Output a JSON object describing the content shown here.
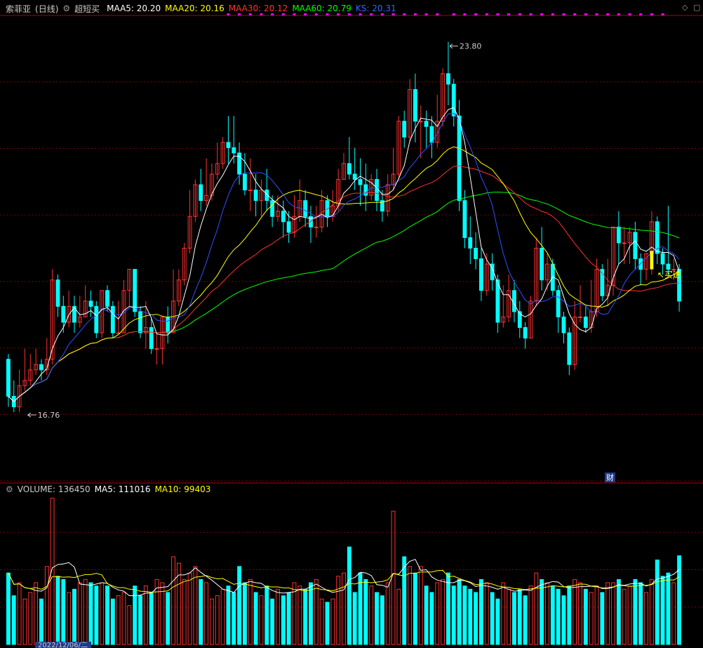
{
  "header": {
    "stock_name": "索菲亚",
    "period": "(日线)",
    "indicator_name": "超短买",
    "ma_labels": [
      {
        "label": "MAA5: 20.20",
        "color": "#ffffff"
      },
      {
        "label": "MAA20: 20.16",
        "color": "#ffff00"
      },
      {
        "label": "MAA30: 20.12",
        "color": "#ff3030"
      },
      {
        "label": "MAA60: 20.79",
        "color": "#00ff00"
      },
      {
        "label": "KS: 20.31",
        "color": "#3050ff"
      }
    ]
  },
  "volume_header": {
    "label": "VOLUME: 136450",
    "ma5": "MA5: 111016",
    "ma10": "MA10: 99403"
  },
  "annotations": {
    "high": "23.80",
    "low": "16.76",
    "buy_signal": "买进",
    "finance_marker": "财",
    "date_footer": "2022/12/06/二"
  },
  "colors": {
    "up": "#ff3030",
    "down": "#00ffff",
    "ma5": "#ffffff",
    "ma20": "#ffff00",
    "ma30": "#ff3030",
    "ma60": "#00ff00",
    "ks": "#3050ff",
    "grid": "#7a0000",
    "signal_dot": "#ff00ff"
  },
  "chart_data": {
    "type": "candlestick",
    "y_range": [
      15.5,
      24.3
    ],
    "volume_range": [
      0,
      230000
    ],
    "candles": [
      [
        17.8,
        17.1,
        17.9,
        16.9,
        110000
      ],
      [
        17.1,
        16.9,
        17.4,
        16.8,
        75000
      ],
      [
        16.9,
        17.3,
        17.6,
        16.8,
        95000
      ],
      [
        17.3,
        17.4,
        18.0,
        17.2,
        70000
      ],
      [
        17.4,
        17.6,
        17.9,
        17.3,
        80000
      ],
      [
        17.6,
        17.7,
        18.0,
        17.5,
        95000
      ],
      [
        17.7,
        17.6,
        17.8,
        17.4,
        70000
      ],
      [
        17.6,
        17.8,
        18.2,
        17.5,
        120000
      ],
      [
        17.8,
        19.3,
        19.5,
        17.7,
        225000
      ],
      [
        19.3,
        18.8,
        19.4,
        18.6,
        105000
      ],
      [
        18.8,
        18.5,
        19.0,
        18.3,
        100000
      ],
      [
        18.5,
        18.8,
        19.1,
        18.4,
        80000
      ],
      [
        18.8,
        18.5,
        19.0,
        18.3,
        85000
      ],
      [
        18.5,
        18.6,
        19.0,
        18.4,
        95000
      ],
      [
        18.6,
        18.9,
        19.2,
        18.6,
        100000
      ],
      [
        18.9,
        18.8,
        19.1,
        18.6,
        95000
      ],
      [
        18.8,
        18.3,
        18.9,
        18.2,
        90000
      ],
      [
        18.3,
        19.1,
        19.1,
        18.2,
        95000
      ],
      [
        19.1,
        18.8,
        19.2,
        18.7,
        90000
      ],
      [
        18.8,
        18.3,
        18.9,
        18.2,
        70000
      ],
      [
        18.3,
        18.3,
        18.9,
        18.3,
        75000
      ],
      [
        18.3,
        19.1,
        19.3,
        18.3,
        80000
      ],
      [
        19.1,
        19.5,
        19.5,
        18.8,
        60000
      ],
      [
        19.5,
        18.7,
        19.5,
        18.6,
        90000
      ],
      [
        18.7,
        18.3,
        18.8,
        18.2,
        75000
      ],
      [
        18.3,
        18.4,
        18.9,
        18.0,
        90000
      ],
      [
        18.4,
        18.0,
        18.6,
        17.9,
        80000
      ],
      [
        18.0,
        18.0,
        18.3,
        17.7,
        100000
      ],
      [
        18.0,
        18.6,
        18.6,
        17.7,
        95000
      ],
      [
        18.6,
        18.3,
        18.8,
        18.1,
        80000
      ],
      [
        18.3,
        18.9,
        19.5,
        18.3,
        135000
      ],
      [
        18.9,
        19.3,
        19.5,
        18.8,
        125000
      ],
      [
        19.3,
        19.9,
        20.0,
        19.2,
        100000
      ],
      [
        19.9,
        20.5,
        21.0,
        19.8,
        110000
      ],
      [
        20.5,
        21.1,
        21.2,
        20.4,
        120000
      ],
      [
        21.1,
        20.8,
        21.4,
        20.6,
        100000
      ],
      [
        20.8,
        20.9,
        21.6,
        20.7,
        95000
      ],
      [
        20.9,
        21.3,
        21.5,
        20.8,
        70000
      ],
      [
        21.3,
        21.5,
        21.9,
        21.2,
        75000
      ],
      [
        21.5,
        21.9,
        22.0,
        21.4,
        85000
      ],
      [
        21.9,
        21.8,
        22.4,
        21.5,
        90000
      ],
      [
        21.8,
        21.7,
        22.4,
        21.5,
        80000
      ],
      [
        21.7,
        21.3,
        21.9,
        21.1,
        120000
      ],
      [
        21.3,
        21.0,
        21.7,
        20.9,
        95000
      ],
      [
        21.0,
        21.0,
        21.6,
        20.6,
        100000
      ],
      [
        21.0,
        20.8,
        21.3,
        20.5,
        80000
      ],
      [
        20.8,
        21.0,
        21.2,
        20.5,
        75000
      ],
      [
        21.0,
        20.8,
        21.4,
        20.6,
        90000
      ],
      [
        20.8,
        20.5,
        20.9,
        20.3,
        70000
      ],
      [
        20.5,
        20.6,
        20.9,
        20.4,
        85000
      ],
      [
        20.6,
        20.4,
        20.8,
        20.1,
        75000
      ],
      [
        20.4,
        20.2,
        20.6,
        20.0,
        80000
      ],
      [
        20.2,
        20.5,
        20.9,
        20.1,
        95000
      ],
      [
        20.5,
        20.8,
        21.2,
        20.4,
        90000
      ],
      [
        20.8,
        20.5,
        21.0,
        20.3,
        85000
      ],
      [
        20.5,
        20.3,
        20.7,
        20.0,
        95000
      ],
      [
        20.3,
        20.3,
        20.7,
        20.1,
        100000
      ],
      [
        20.3,
        20.8,
        21.0,
        20.2,
        70000
      ],
      [
        20.8,
        20.5,
        20.9,
        20.3,
        65000
      ],
      [
        20.5,
        20.7,
        21.0,
        20.4,
        70000
      ],
      [
        20.7,
        21.2,
        21.4,
        20.6,
        105000
      ],
      [
        21.2,
        21.5,
        21.7,
        21.2,
        110000
      ],
      [
        21.5,
        21.3,
        22.0,
        21.2,
        150000
      ],
      [
        21.3,
        21.2,
        21.8,
        21.0,
        80000
      ],
      [
        21.2,
        21.1,
        21.6,
        20.7,
        110000
      ],
      [
        21.1,
        20.9,
        21.5,
        20.6,
        100000
      ],
      [
        20.9,
        21.2,
        21.3,
        20.8,
        90000
      ],
      [
        21.2,
        20.8,
        21.4,
        20.6,
        80000
      ],
      [
        20.8,
        20.6,
        21.0,
        20.4,
        75000
      ],
      [
        20.6,
        21.1,
        21.3,
        20.5,
        95000
      ],
      [
        21.1,
        21.3,
        21.8,
        21.0,
        205000
      ],
      [
        21.3,
        22.3,
        22.4,
        21.2,
        85000
      ],
      [
        22.3,
        22.0,
        22.5,
        21.8,
        135000
      ],
      [
        22.0,
        22.9,
        23.1,
        21.9,
        120000
      ],
      [
        22.9,
        22.3,
        23.2,
        21.9,
        110000
      ],
      [
        22.3,
        22.3,
        22.6,
        21.6,
        120000
      ],
      [
        22.3,
        22.2,
        22.5,
        21.8,
        90000
      ],
      [
        22.2,
        21.9,
        22.4,
        21.6,
        80000
      ],
      [
        21.9,
        22.3,
        22.8,
        21.8,
        95000
      ],
      [
        22.3,
        23.2,
        23.3,
        22.2,
        100000
      ],
      [
        23.2,
        23.0,
        23.8,
        22.6,
        110000
      ],
      [
        23.0,
        22.4,
        23.1,
        22.2,
        90000
      ],
      [
        22.4,
        20.8,
        22.7,
        20.6,
        100000
      ],
      [
        20.8,
        20.1,
        21.0,
        19.9,
        90000
      ],
      [
        20.1,
        19.9,
        20.5,
        19.6,
        85000
      ],
      [
        19.9,
        19.7,
        20.2,
        19.5,
        80000
      ],
      [
        19.7,
        19.1,
        19.9,
        18.9,
        100000
      ],
      [
        19.1,
        19.6,
        19.8,
        19.0,
        95000
      ],
      [
        19.6,
        19.3,
        19.8,
        19.1,
        80000
      ],
      [
        19.3,
        18.5,
        19.4,
        18.3,
        70000
      ],
      [
        18.5,
        18.6,
        19.2,
        18.4,
        95000
      ],
      [
        18.6,
        19.1,
        19.4,
        18.5,
        85000
      ],
      [
        19.1,
        18.7,
        19.3,
        18.5,
        80000
      ],
      [
        18.7,
        18.4,
        18.9,
        18.2,
        85000
      ],
      [
        18.4,
        18.2,
        18.5,
        18.0,
        75000
      ],
      [
        18.2,
        18.9,
        19.0,
        18.2,
        90000
      ],
      [
        18.9,
        19.9,
        20.1,
        18.8,
        110000
      ],
      [
        19.9,
        19.3,
        20.3,
        19.1,
        100000
      ],
      [
        19.3,
        19.6,
        19.8,
        19.1,
        95000
      ],
      [
        19.6,
        19.1,
        19.7,
        19.0,
        90000
      ],
      [
        19.1,
        18.6,
        19.2,
        18.3,
        85000
      ],
      [
        18.6,
        18.3,
        18.7,
        18.1,
        75000
      ],
      [
        18.3,
        17.7,
        18.4,
        17.5,
        90000
      ],
      [
        17.7,
        18.6,
        18.9,
        17.6,
        100000
      ],
      [
        18.6,
        18.6,
        19.2,
        18.5,
        95000
      ],
      [
        18.6,
        18.4,
        18.8,
        18.3,
        85000
      ],
      [
        18.4,
        18.7,
        19.3,
        18.3,
        80000
      ],
      [
        18.7,
        19.5,
        19.7,
        18.6,
        90000
      ],
      [
        19.5,
        19.0,
        19.6,
        18.9,
        80000
      ],
      [
        19.0,
        19.2,
        19.7,
        18.8,
        95000
      ],
      [
        19.2,
        20.3,
        20.3,
        19.0,
        95000
      ],
      [
        20.3,
        20.0,
        20.6,
        19.6,
        100000
      ],
      [
        20.0,
        20.0,
        20.3,
        19.6,
        85000
      ],
      [
        20.0,
        20.2,
        20.3,
        19.6,
        90000
      ],
      [
        20.2,
        19.7,
        20.4,
        19.5,
        100000
      ],
      [
        19.7,
        19.5,
        19.8,
        19.2,
        95000
      ],
      [
        19.5,
        19.8,
        19.8,
        19.3,
        80000
      ],
      [
        19.8,
        20.4,
        20.6,
        19.4,
        100000
      ],
      [
        20.4,
        19.8,
        20.5,
        19.6,
        130000
      ],
      [
        19.8,
        19.6,
        19.9,
        19.4,
        105000
      ],
      [
        19.6,
        19.5,
        20.7,
        19.4,
        110000
      ],
      [
        19.5,
        19.5,
        19.7,
        19.3,
        95000
      ],
      [
        19.5,
        18.9,
        19.6,
        18.7,
        136450
      ]
    ],
    "signal_dots_count": 40
  }
}
